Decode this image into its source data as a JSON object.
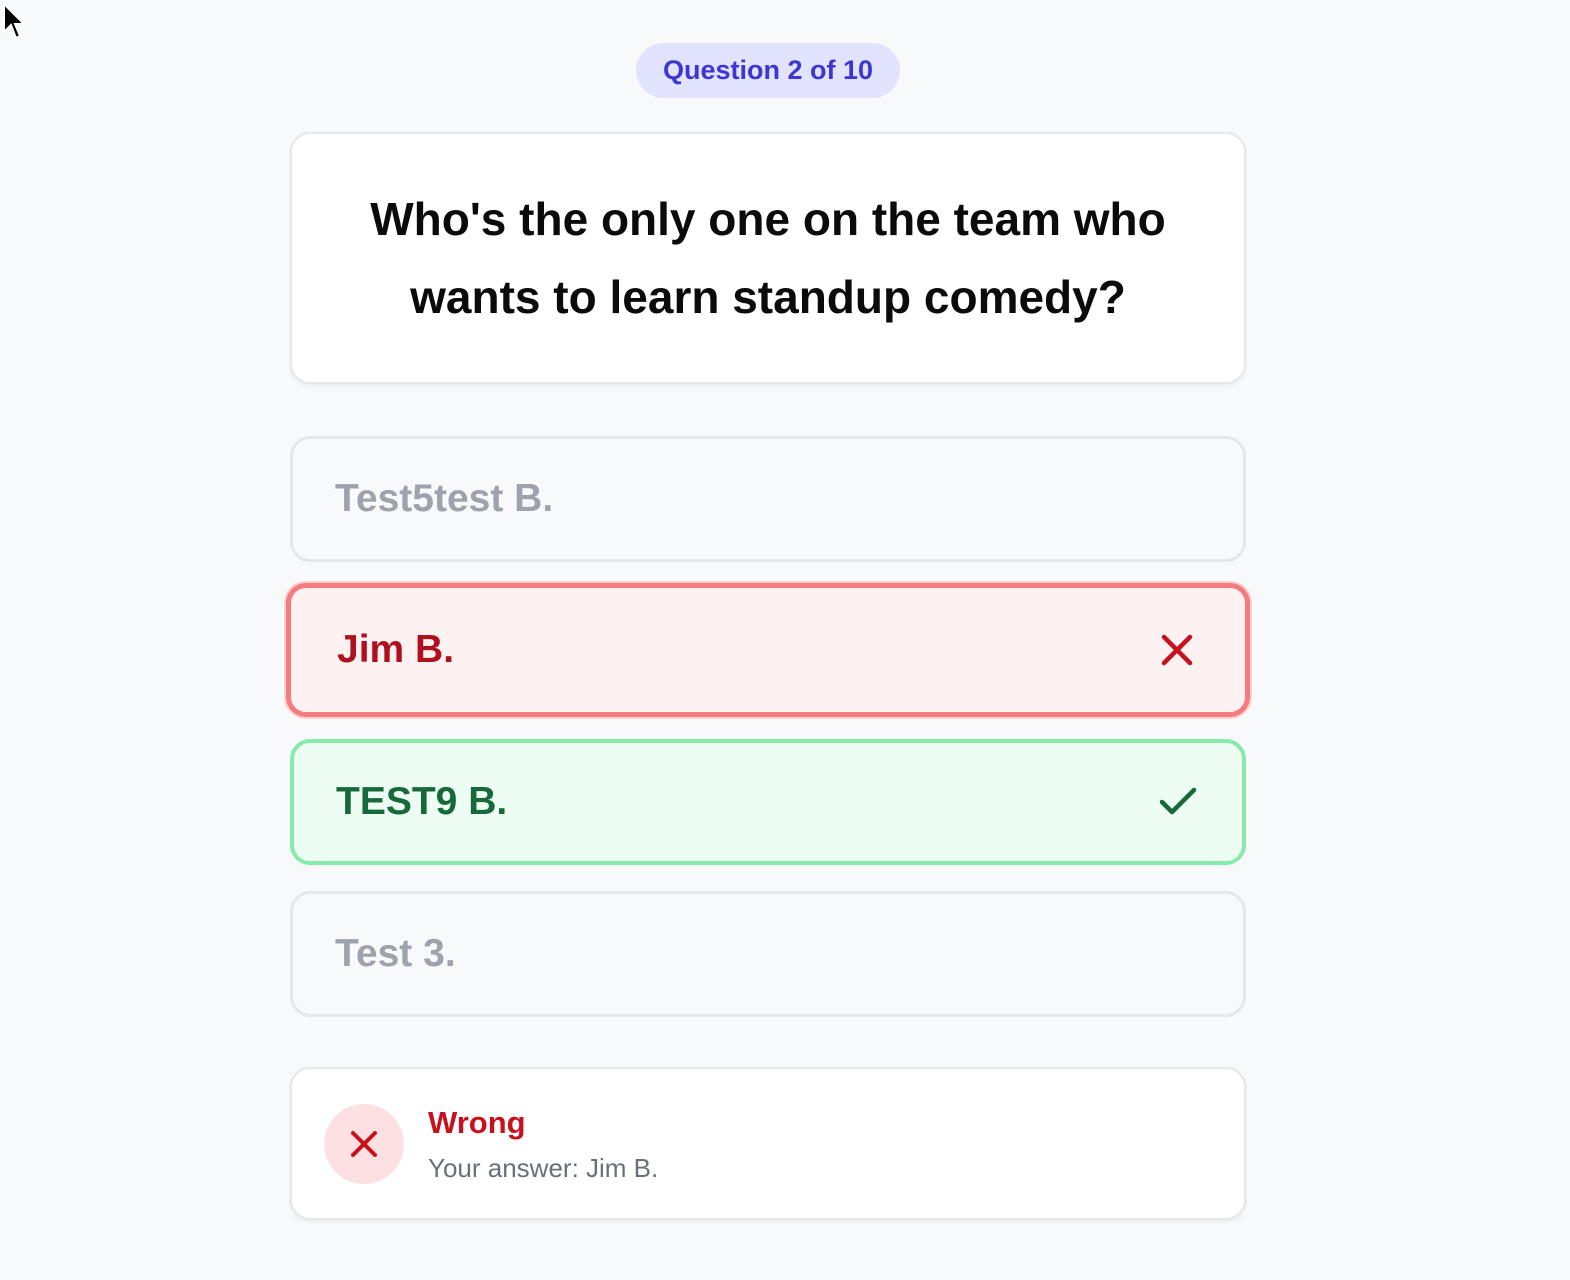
{
  "progress": {
    "label": "Question 2 of 10"
  },
  "question": {
    "text": "Who's the only one on the team who wants to learn standup comedy?"
  },
  "options": [
    {
      "label": "Test5test B.",
      "state": "neutral",
      "icon": ""
    },
    {
      "label": "Jim B.",
      "state": "wrong",
      "icon": "x-icon"
    },
    {
      "label": "TEST9 B.",
      "state": "correct",
      "icon": "check-icon"
    },
    {
      "label": "Test 3.",
      "state": "neutral",
      "icon": ""
    }
  ],
  "result": {
    "title": "Wrong",
    "detail": "Your answer: Jim B.",
    "icon": "x-icon"
  },
  "colors": {
    "badge_bg": "#e2e4fe",
    "badge_text": "#3f35d4",
    "wrong_border": "#f47b7e",
    "wrong_text": "#b0101e",
    "correct_border": "#86eaa8",
    "correct_text": "#17693a"
  }
}
